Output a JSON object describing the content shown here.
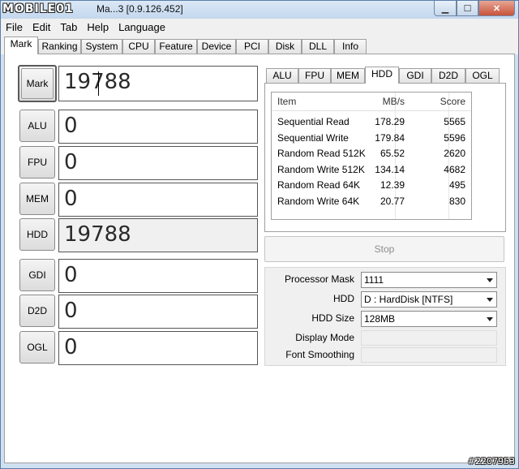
{
  "window": {
    "logo": "MOBILE01",
    "title": "Ma...3 [0.9.126.452]",
    "controls": {
      "minimize": "▁",
      "maximize": "☐",
      "close": "✕"
    }
  },
  "menu": [
    "File",
    "Edit",
    "Tab",
    "Help",
    "Language"
  ],
  "main_tabs": [
    "Mark",
    "Ranking",
    "System",
    "CPU",
    "Feature",
    "Device",
    "PCI",
    "Disk",
    "DLL",
    "Info"
  ],
  "active_main_tab": "Mark",
  "benchmarks": [
    {
      "label": "Mark",
      "score": "19788"
    },
    {
      "label": "ALU",
      "score": "0"
    },
    {
      "label": "FPU",
      "score": "0"
    },
    {
      "label": "MEM",
      "score": "0"
    },
    {
      "label": "HDD",
      "score": "19788"
    },
    {
      "label": "GDI",
      "score": "0"
    },
    {
      "label": "D2D",
      "score": "0"
    },
    {
      "label": "OGL",
      "score": "0"
    }
  ],
  "detail_tabs": [
    "ALU",
    "FPU",
    "MEM",
    "HDD",
    "GDI",
    "D2D",
    "OGL"
  ],
  "active_detail_tab": "HDD",
  "results": {
    "columns": [
      "Item",
      "MB/s",
      "Score"
    ],
    "rows": [
      [
        "Sequential Read",
        "178.29",
        "5565"
      ],
      [
        "Sequential Write",
        "179.84",
        "5596"
      ],
      [
        "Random Read 512K",
        "65.52",
        "2620"
      ],
      [
        "Random Write 512K",
        "134.14",
        "4682"
      ],
      [
        "Random Read 64K",
        "12.39",
        "495"
      ],
      [
        "Random Write 64K",
        "20.77",
        "830"
      ]
    ]
  },
  "stop_button": "Stop",
  "settings": {
    "processor_mask": {
      "label": "Processor Mask",
      "value": "1111"
    },
    "hdd": {
      "label": "HDD",
      "value": "D : HardDisk [NTFS]"
    },
    "hdd_size": {
      "label": "HDD Size",
      "value": "128MB"
    },
    "display_mode": {
      "label": "Display Mode",
      "value": ""
    },
    "font_smoothing": {
      "label": "Font Smoothing",
      "value": ""
    }
  },
  "watermark": "#2207953"
}
